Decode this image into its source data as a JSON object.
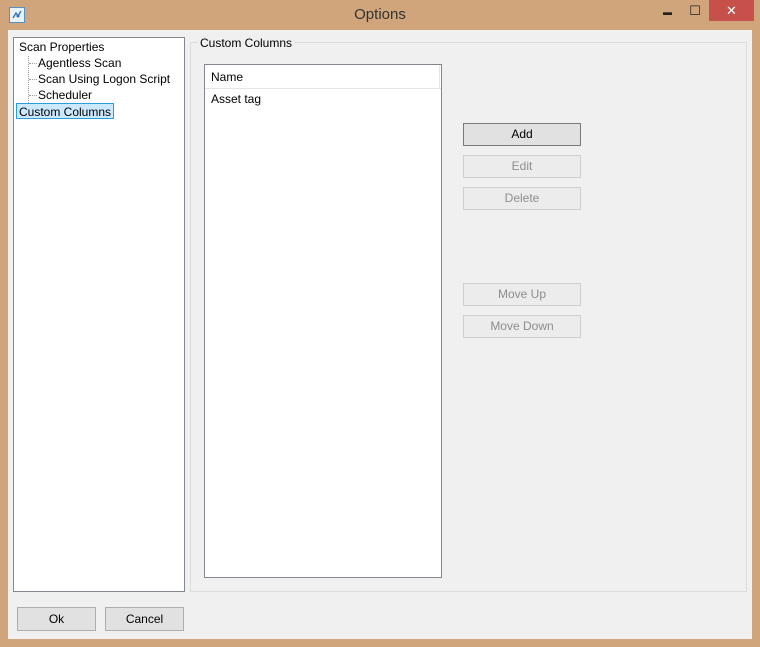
{
  "window": {
    "title": "Options",
    "controls": {
      "minimize": "▬",
      "maximize": "☐",
      "close": "✕"
    }
  },
  "tree": {
    "items": [
      {
        "label": "Scan Properties"
      },
      {
        "label": "Agentless Scan"
      },
      {
        "label": "Scan Using Logon Script"
      },
      {
        "label": "Scheduler"
      },
      {
        "label": "Custom Columns",
        "selected": true
      }
    ]
  },
  "group": {
    "title": "Custom Columns",
    "list": {
      "header": "Name",
      "rows": [
        "Asset tag"
      ]
    },
    "buttons": {
      "add": "Add",
      "edit": "Edit",
      "delete": "Delete",
      "move_up": "Move Up",
      "move_down": "Move Down"
    }
  },
  "footer": {
    "ok": "Ok",
    "cancel": "Cancel"
  },
  "colors": {
    "frame": "#d0a57b",
    "close_button": "#c7504b",
    "selection": "#cce8ff"
  }
}
